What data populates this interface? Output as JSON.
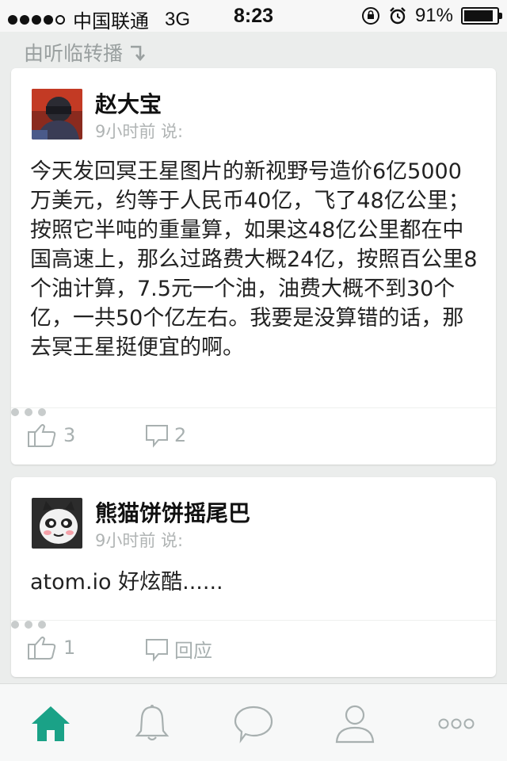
{
  "status_bar": {
    "carrier": "中国联通",
    "network": "3G",
    "time": "8:23",
    "battery_percent": "91%",
    "battery_level": 0.91
  },
  "repost_header": {
    "label": "由听临转播",
    "icon": "arrow-down-right-icon"
  },
  "posts": [
    {
      "author": "赵大宝",
      "meta": "9小时前 说:",
      "content": "今天发回冥王星图片的新视野号造价6亿5000万美元，约等于人民币40亿，飞了48亿公里；按照它半吨的重量算，如果这48亿公里都在中国高速上，那么过路费大概24亿，按照百公里8个油计算，7.5元一个油，油费大概不到30个亿，一共50个亿左右。我要是没算错的话，那去冥王星挺便宜的啊。",
      "likes": "3",
      "comments": "2"
    },
    {
      "author": "熊猫饼饼摇尾巴",
      "meta": "9小时前 说:",
      "content": "atom.io 好炫酷......",
      "likes": "1",
      "comments": "回应"
    }
  ],
  "tab_bar": {
    "active": "home",
    "tabs": [
      "home-icon",
      "bell-icon",
      "chat-icon",
      "person-icon",
      "more-icon"
    ]
  },
  "colors": {
    "accent": "#1aa287",
    "icon_gray": "#a8b0b0",
    "background": "#ebedec"
  }
}
